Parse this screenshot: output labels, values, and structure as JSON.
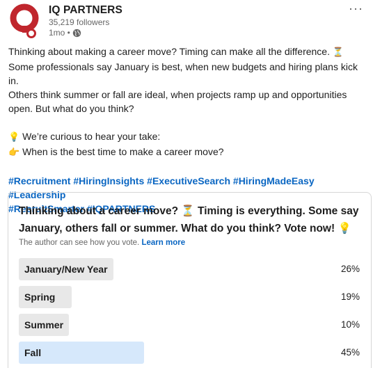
{
  "post": {
    "company": "IQ PARTNERS",
    "followers": "35,219 followers",
    "time": "1mo •",
    "more": "···",
    "body": {
      "line1": "Thinking about making a career move? Timing can make all the difference.",
      "emoji1": "⏳",
      "line2": "Some professionals say January is best, when new budgets and hiring plans kick in.",
      "line3": "Others think summer or fall are ideal, when projects ramp up and opportunities",
      "line4": "open. But what do you think?",
      "bulb": "💡",
      "line5": "We’re curious to hear your take:",
      "point": "👉",
      "line6": "When is the best time to make a career move?"
    },
    "hashtags": [
      "#Recruitment",
      "#HiringInsights",
      "#ExecutiveSearch",
      "#HiringMadeEasy",
      "#Leadership",
      "#RecruitSmarter",
      "#IQPARTNERS"
    ]
  },
  "poll": {
    "question_line1": "Thinking about a career move? ⏳ Timing is everything. Some say",
    "question_line2": "January, others fall or summer. What do you think? Vote now! 💡",
    "note": "The author can see how you vote.",
    "learn_more": "Learn more",
    "options": [
      {
        "label": "January/New Year",
        "percent": "26%",
        "value": 26,
        "selected": false
      },
      {
        "label": "Spring",
        "percent": "19%",
        "value": 19,
        "selected": false
      },
      {
        "label": "Summer",
        "percent": "10%",
        "value": 10,
        "selected": false
      },
      {
        "label": "Fall",
        "percent": "45%",
        "value": 45,
        "selected": true
      }
    ]
  },
  "colors": {
    "brand_red": "#c0262d",
    "link_blue": "#0a66c2",
    "bar_gray": "#e8e8e8",
    "bar_selected": "#d6e8fb"
  }
}
